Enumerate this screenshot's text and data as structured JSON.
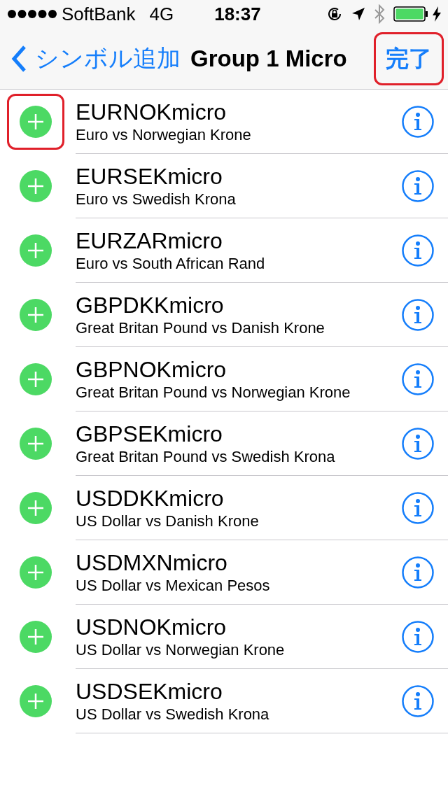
{
  "status_bar": {
    "carrier": "SoftBank",
    "network": "4G",
    "time": "18:37"
  },
  "nav": {
    "back": "シンボル追加",
    "title": "Group 1 Micro",
    "done": "完了",
    "done_highlighted": true
  },
  "rows": [
    {
      "symbol": "EURNOKmicro",
      "description": "Euro vs Norwegian Krone",
      "highlighted": true
    },
    {
      "symbol": "EURSEKmicro",
      "description": "Euro vs Swedish Krona",
      "highlighted": false
    },
    {
      "symbol": "EURZARmicro",
      "description": "Euro vs South African Rand",
      "highlighted": false
    },
    {
      "symbol": "GBPDKKmicro",
      "description": "Great Britan Pound vs Danish Krone",
      "highlighted": false
    },
    {
      "symbol": "GBPNOKmicro",
      "description": "Great Britan Pound vs Norwegian Krone",
      "highlighted": false
    },
    {
      "symbol": "GBPSEKmicro",
      "description": "Great Britan Pound vs Swedish Krona",
      "highlighted": false
    },
    {
      "symbol": "USDDKKmicro",
      "description": "US Dollar vs Danish Krone",
      "highlighted": false
    },
    {
      "symbol": "USDMXNmicro",
      "description": "US Dollar vs Mexican Pesos",
      "highlighted": false
    },
    {
      "symbol": "USDNOKmicro",
      "description": "US Dollar vs Norwegian Krone",
      "highlighted": false
    },
    {
      "symbol": "USDSEKmicro",
      "description": "US Dollar vs Swedish Krona",
      "highlighted": false
    }
  ]
}
